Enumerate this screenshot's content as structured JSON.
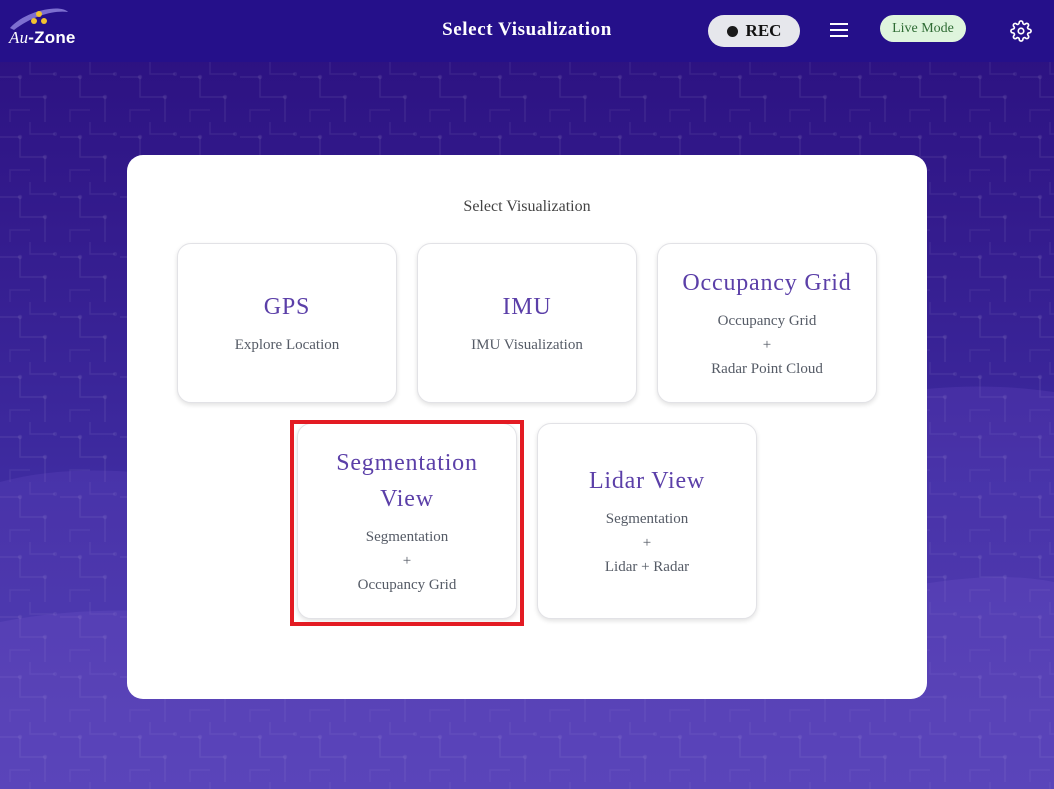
{
  "header": {
    "logo": {
      "prefix": "Au",
      "suffix": "-Zone"
    },
    "title": "Select Visualization",
    "rec_label": "REC",
    "live_mode_label": "Live Mode"
  },
  "panel": {
    "title": "Select Visualization",
    "cards": [
      {
        "title": "GPS",
        "lines": [
          "Explore Location"
        ]
      },
      {
        "title": "IMU",
        "lines": [
          "IMU Visualization"
        ]
      },
      {
        "title": "Occupancy Grid",
        "lines": [
          "Occupancy Grid",
          "+",
          "Radar Point Cloud"
        ]
      },
      {
        "title_lines": [
          "Segmentation",
          "View"
        ],
        "lines": [
          "Segmentation",
          "+",
          "Occupancy Grid"
        ]
      },
      {
        "title": "Lidar View",
        "lines": [
          "Segmentation",
          "+",
          "Lidar + Radar"
        ]
      }
    ]
  },
  "colors": {
    "header_bg": "#25108a",
    "card_title": "#5b3fa8",
    "highlight": "#e31b23",
    "live_badge_bg": "#dff5dd"
  }
}
